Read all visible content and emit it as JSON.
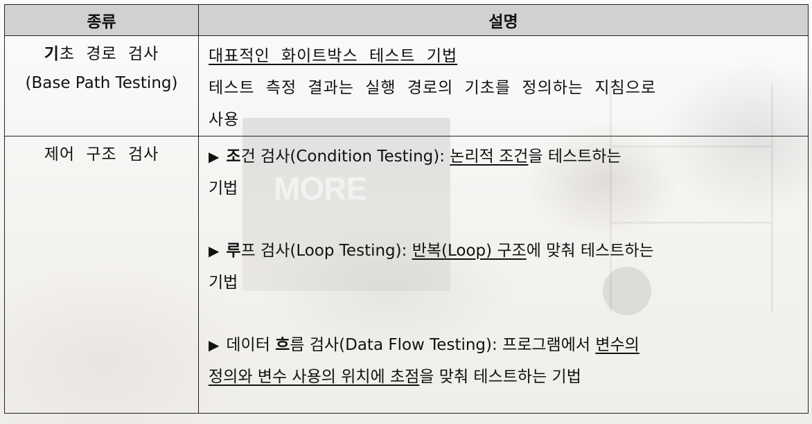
{
  "table": {
    "headers": [
      "종류",
      "설명"
    ],
    "rows": [
      {
        "kind": {
          "bold_prefix": "기",
          "rest": "초 경로 검사",
          "sub": "(Base Path Testing)"
        },
        "desc": {
          "line1_underlined": "대표적인 화이트박스 테스트 기법",
          "line2": "테스트 측정 결과는 실행 경로의 기초를 정의하는 지침으로",
          "line3": "사용"
        }
      },
      {
        "kind": {
          "label": "제어 구조 검사"
        },
        "items": [
          {
            "marker": "▶",
            "bold_prefix": "조",
            "name": "건 검사(Condition Testing): ",
            "underlined": "논리적 조건",
            "after": "을 테스트하는",
            "wrap": "기법"
          },
          {
            "marker": "▶",
            "bold_prefix": "루",
            "name": "프 검사(Loop Testing): ",
            "underlined": "반복(Loop) 구조",
            "after": "에 맞춰 테스트하는",
            "wrap": "기법"
          },
          {
            "marker": "▶",
            "pre": "데이터 ",
            "bold_prefix": "흐",
            "name": "름 검사(Data Flow Testing): 프로그램에서 ",
            "underlined": "변수의 ",
            "wrap_underlined": "정의와 변수 사용의 위치에 초점",
            "wrap_after": "을 맞춰 테스트하는 기법"
          }
        ]
      }
    ]
  },
  "background": {
    "monitor_text": "MORE"
  }
}
